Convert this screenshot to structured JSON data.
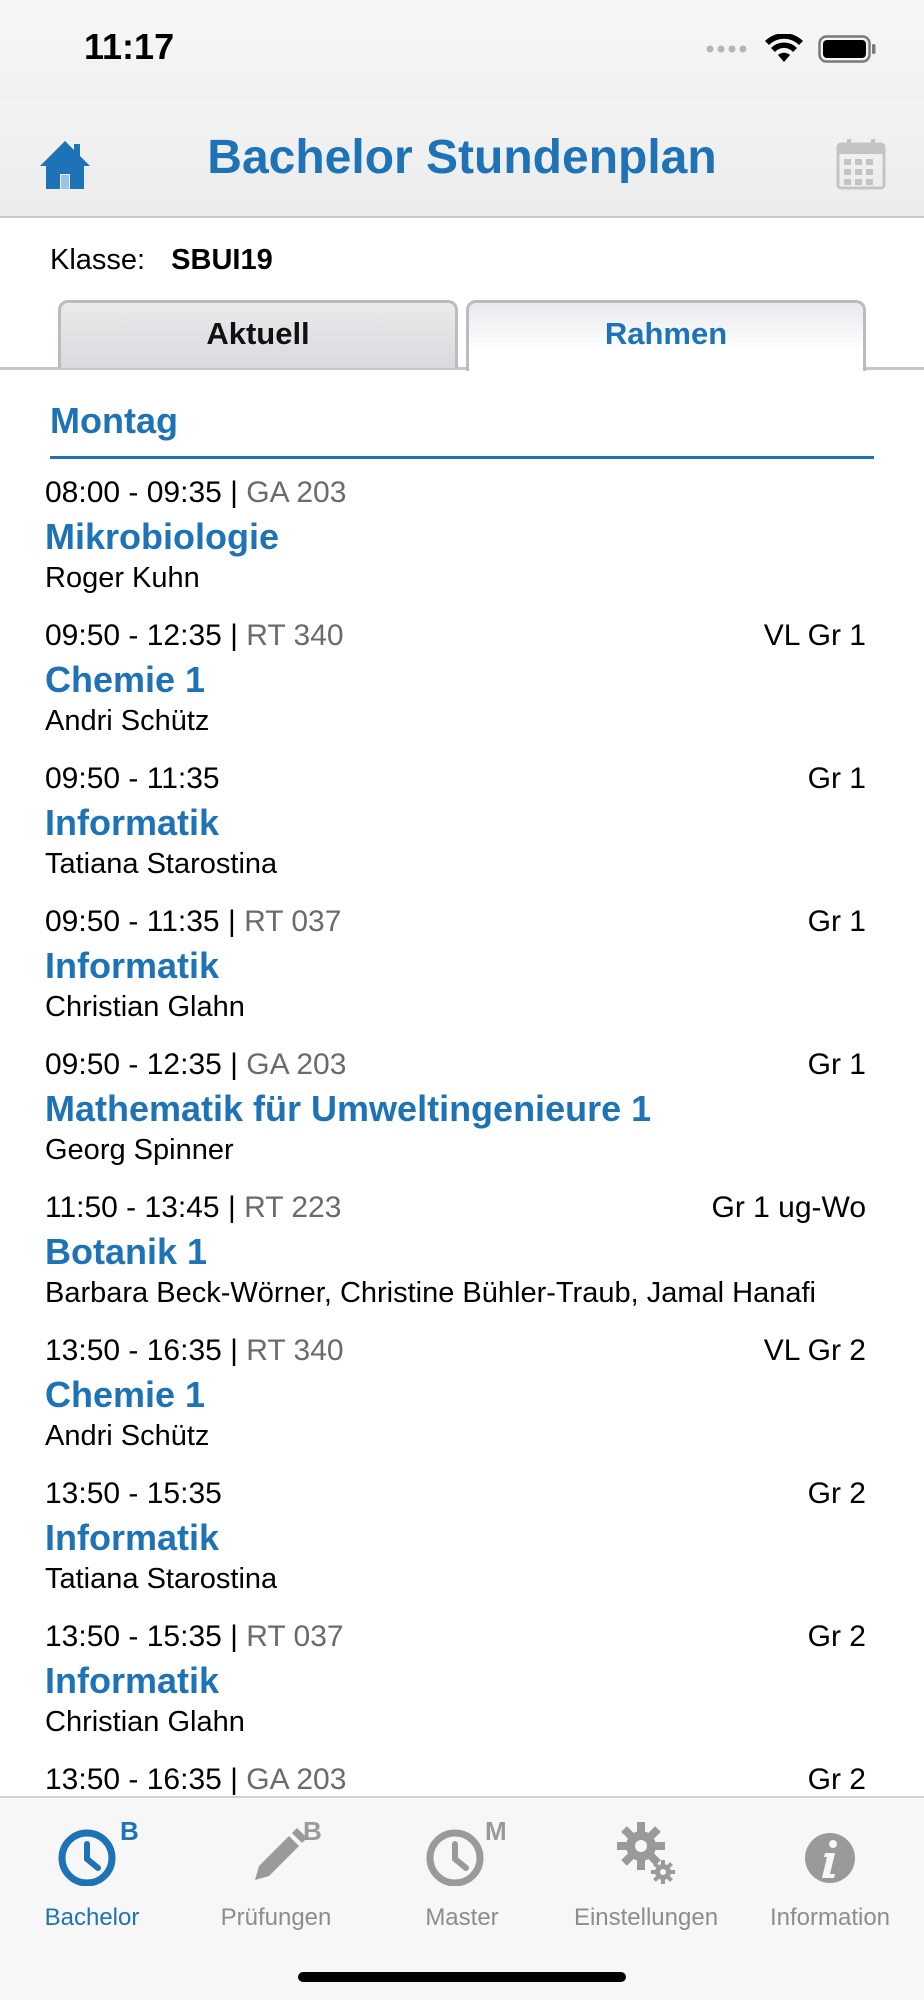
{
  "status": {
    "time": "11:17"
  },
  "header": {
    "title": "Bachelor Stundenplan",
    "home_icon": "home-icon",
    "calendar_icon": "calendar-icon",
    "accent": "#1d73b6"
  },
  "klasse": {
    "label": "Klasse:",
    "value": "SBUI19"
  },
  "tabs": [
    {
      "label": "Aktuell",
      "selected": false
    },
    {
      "label": "Rahmen",
      "selected": true
    }
  ],
  "day": "Montag",
  "entries": [
    {
      "time": "08:00 - 09:35",
      "sep": "|",
      "room": "GA 203",
      "group": "",
      "subject": "Mikrobiologie",
      "teacher": "Roger Kuhn"
    },
    {
      "time": "09:50 - 12:35",
      "sep": "|",
      "room": "RT 340",
      "group": "VL Gr 1",
      "subject": "Chemie 1",
      "teacher": "Andri Schütz"
    },
    {
      "time": "09:50 - 11:35",
      "sep": "",
      "room": "",
      "group": "Gr 1",
      "subject": "Informatik",
      "teacher": "Tatiana Starostina"
    },
    {
      "time": "09:50 - 11:35",
      "sep": "|",
      "room": "RT 037",
      "group": "Gr 1",
      "subject": "Informatik",
      "teacher": "Christian Glahn"
    },
    {
      "time": "09:50 - 12:35",
      "sep": "|",
      "room": "GA 203",
      "group": "Gr 1",
      "subject": "Mathematik für Umweltingenieure 1",
      "teacher": "Georg Spinner"
    },
    {
      "time": "11:50 - 13:45",
      "sep": "|",
      "room": "RT 223",
      "group": "Gr 1 ug-Wo",
      "subject": "Botanik 1",
      "teacher": "Barbara Beck-Wörner, Christine Bühler-Traub, Jamal Hanafi"
    },
    {
      "time": "13:50 - 16:35",
      "sep": "|",
      "room": "RT 340",
      "group": "VL Gr 2",
      "subject": "Chemie 1",
      "teacher": "Andri Schütz"
    },
    {
      "time": "13:50 - 15:35",
      "sep": "",
      "room": "",
      "group": "Gr 2",
      "subject": "Informatik",
      "teacher": "Tatiana Starostina"
    },
    {
      "time": "13:50 - 15:35",
      "sep": "|",
      "room": "RT 037",
      "group": "Gr 2",
      "subject": "Informatik",
      "teacher": "Christian Glahn"
    },
    {
      "time": "13:50 - 16:35",
      "sep": "|",
      "room": "GA 203",
      "group": "Gr 2",
      "subject": "",
      "teacher": ""
    }
  ],
  "tabbar": {
    "items": [
      {
        "label": "Bachelor",
        "icon": "clock-b-icon",
        "active": true
      },
      {
        "label": "Prüfungen",
        "icon": "pencil-b-icon",
        "active": false
      },
      {
        "label": "Master",
        "icon": "clock-m-icon",
        "active": false
      },
      {
        "label": "Einstellungen",
        "icon": "gears-icon",
        "active": false
      },
      {
        "label": "Information",
        "icon": "info-icon",
        "active": false
      }
    ],
    "badges": {
      "bachelor": "B",
      "pruefungen": "B",
      "master": "M"
    }
  }
}
